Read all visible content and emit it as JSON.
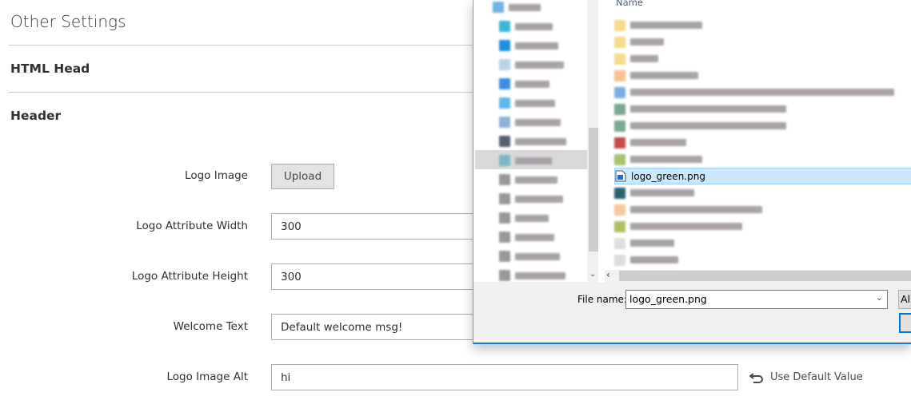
{
  "page": {
    "title": "Other Settings",
    "sections": [
      "HTML Head",
      "Header"
    ],
    "fields": [
      {
        "label": "Logo Image",
        "button": "Upload"
      },
      {
        "label": "Logo Attribute Width",
        "value": "300"
      },
      {
        "label": "Logo Attribute Height",
        "value": "300"
      },
      {
        "label": "Welcome Text",
        "value": "Default welcome msg!"
      },
      {
        "label": "Logo Image Alt",
        "value": "hi",
        "use_default": "Use Default Value"
      }
    ]
  },
  "dialog": {
    "column_header": "Name",
    "selected_file": "logo_green.png",
    "file_name_label": "File name:",
    "file_name_value": "logo_green.png",
    "filter_label": "All",
    "accent": "#0078d7",
    "selection_color": "#cce8ff"
  }
}
